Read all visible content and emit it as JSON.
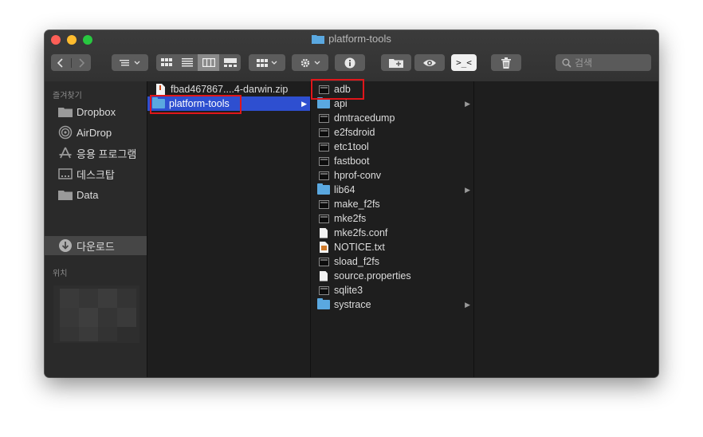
{
  "window": {
    "title": "platform-tools"
  },
  "toolbar": {
    "back_icon": "chevron-left",
    "forward_icon": "chevron-right",
    "search_placeholder": "검색",
    "terminal_label": ">_<"
  },
  "sidebar": {
    "favorites_header": "즐겨찾기",
    "items": [
      {
        "label": "Dropbox",
        "icon": "folder-icon"
      },
      {
        "label": "AirDrop",
        "icon": "airdrop-icon"
      },
      {
        "label": "응용 프로그램",
        "icon": "applications-icon"
      },
      {
        "label": "데스크탑",
        "icon": "desktop-icon"
      },
      {
        "label": "Data",
        "icon": "folder-icon"
      },
      {
        "label": "다운로드",
        "icon": "download-icon"
      }
    ],
    "locations_header": "위치"
  },
  "column1": {
    "items": [
      {
        "name": "fbad467867....4-darwin.zip",
        "type": "zip"
      },
      {
        "name": "platform-tools",
        "type": "folder",
        "selected": true
      }
    ]
  },
  "column2": {
    "items": [
      {
        "name": "adb",
        "type": "exec"
      },
      {
        "name": "api",
        "type": "folder"
      },
      {
        "name": "dmtracedump",
        "type": "exec"
      },
      {
        "name": "e2fsdroid",
        "type": "exec"
      },
      {
        "name": "etc1tool",
        "type": "exec"
      },
      {
        "name": "fastboot",
        "type": "exec"
      },
      {
        "name": "hprof-conv",
        "type": "exec"
      },
      {
        "name": "lib64",
        "type": "folder"
      },
      {
        "name": "make_f2fs",
        "type": "exec"
      },
      {
        "name": "mke2fs",
        "type": "exec"
      },
      {
        "name": "mke2fs.conf",
        "type": "doc"
      },
      {
        "name": "NOTICE.txt",
        "type": "txt"
      },
      {
        "name": "sload_f2fs",
        "type": "exec"
      },
      {
        "name": "source.properties",
        "type": "doc"
      },
      {
        "name": "sqlite3",
        "type": "exec"
      },
      {
        "name": "systrace",
        "type": "folder"
      }
    ]
  },
  "colors": {
    "selection": "#2e4fd0",
    "highlight_box": "#e0161a",
    "folder": "#5aa8e0"
  }
}
